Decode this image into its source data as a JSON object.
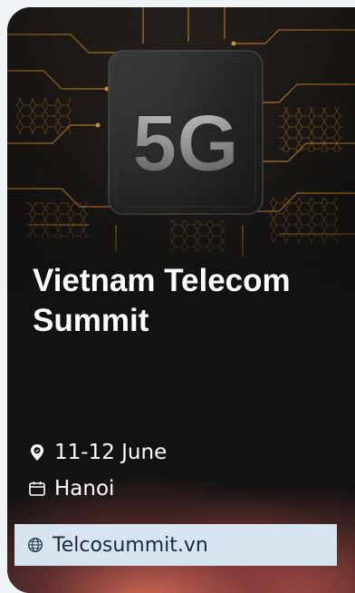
{
  "event": {
    "title": "Vietnam Telecom Summit",
    "date": "11-12 June",
    "location": "Hanoi",
    "website": "Telcosummit.vn"
  },
  "hero": {
    "chip_label": "5G",
    "image_subject": "5g-chip-circuit-board"
  },
  "icons": {
    "date": "location-pin-icon",
    "location": "calendar-icon",
    "website": "globe-icon"
  },
  "colors": {
    "card_bg": "#121212",
    "circuit_orange": "#e39a2b",
    "link_bar_bg": "#d7e5f0",
    "text_light": "#ffffff",
    "text_dark": "#1a2a3a"
  }
}
